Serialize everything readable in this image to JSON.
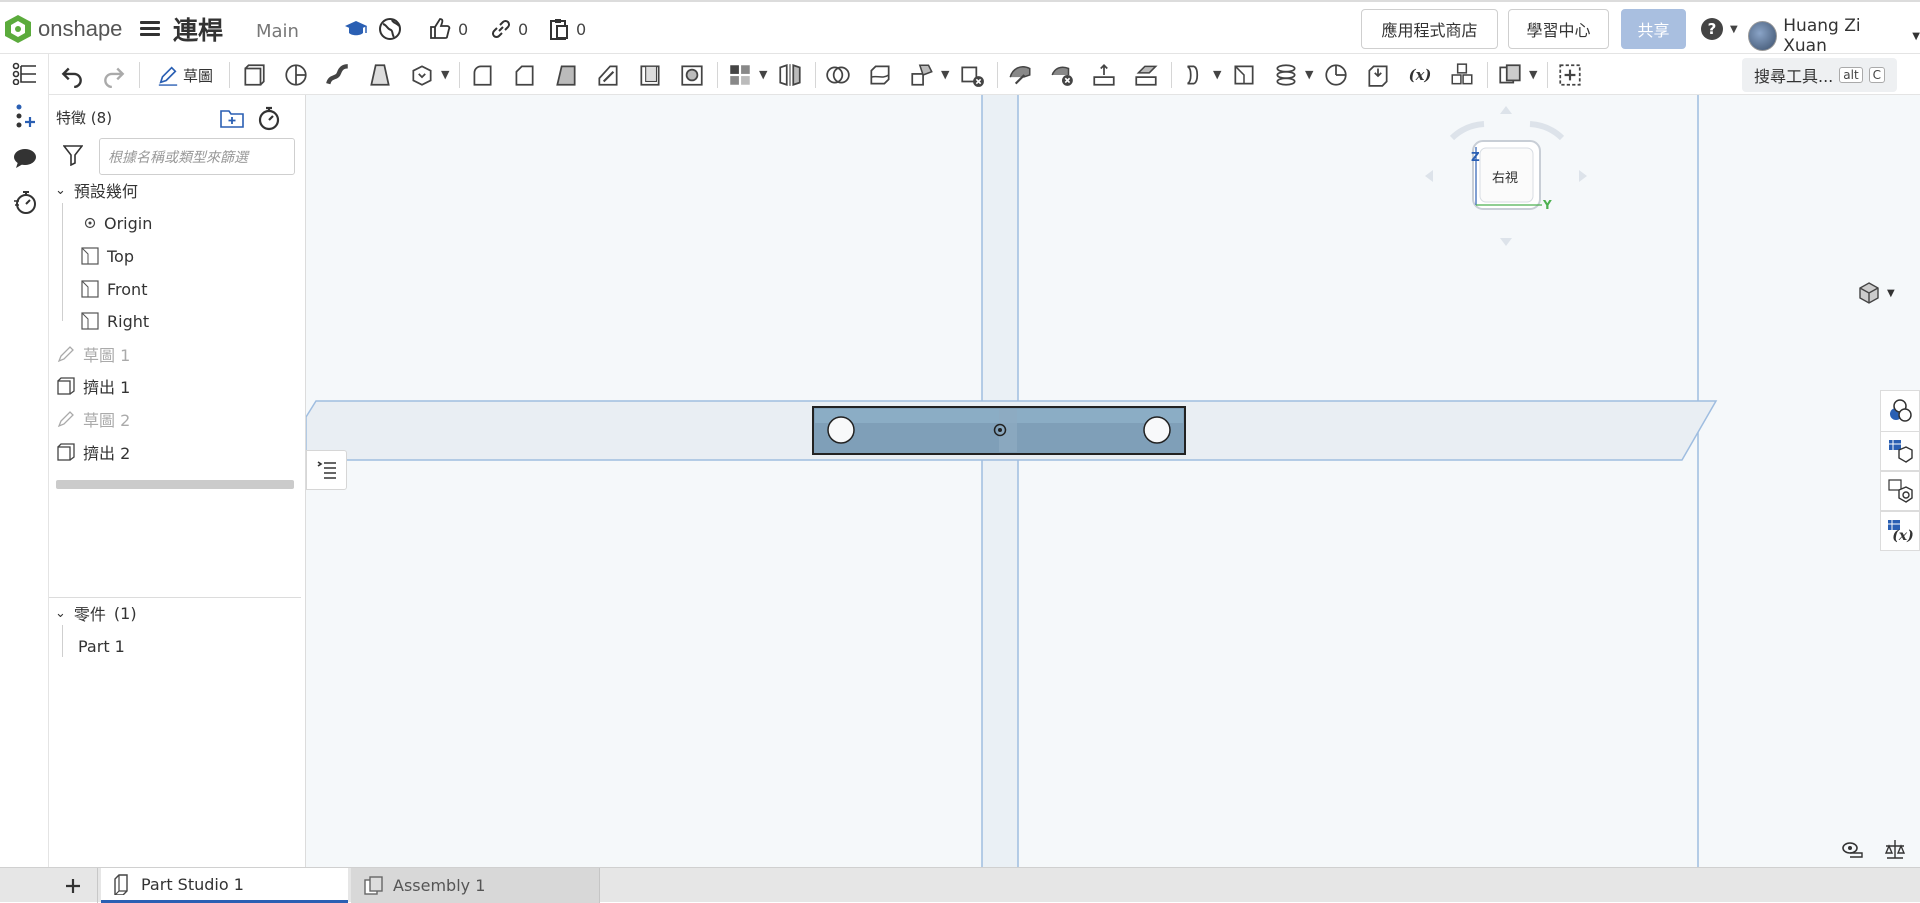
{
  "brand": {
    "name": "onshape"
  },
  "document": {
    "title": "連桿",
    "branch": "Main"
  },
  "counts": {
    "likes": "0",
    "links": "0",
    "copies": "0"
  },
  "header_buttons": {
    "app_store": "應用程式商店",
    "learning_center": "學習中心",
    "share": "共享"
  },
  "user": {
    "name": "Huang Zi Xuan"
  },
  "toolbar": {
    "sketch_label": "草圖",
    "search_label": "搜尋工具...",
    "search_key1": "alt",
    "search_key2": "C"
  },
  "feature_panel": {
    "header_label": "特徵",
    "header_count": "(8)",
    "filter_placeholder": "根據名稱或類型來篩選",
    "default_geometry_label": "預設幾何",
    "geometry_items": [
      "Origin",
      "Top",
      "Front",
      "Right"
    ],
    "features": [
      {
        "label": "草圖 1",
        "type": "sketch",
        "muted": true
      },
      {
        "label": "擠出 1",
        "type": "extrude",
        "muted": false
      },
      {
        "label": "草圖 2",
        "type": "sketch",
        "muted": true
      },
      {
        "label": "擠出 2",
        "type": "extrude",
        "muted": false
      }
    ],
    "parts_label": "零件",
    "parts_count": "(1)",
    "parts": [
      "Part 1"
    ]
  },
  "viewcube": {
    "face_label": "右視",
    "axis_z": "Z",
    "axis_y": "Y"
  },
  "tabs": [
    {
      "label": "Part Studio 1",
      "active": true
    },
    {
      "label": "Assembly 1",
      "active": false
    }
  ],
  "colors": {
    "accent": "#2a5fb3",
    "share_button": "#a9bfe0",
    "part_fill": "#7f9fb8",
    "plane_stroke": "#9fbde0",
    "canvas_bg": "#f5f8fa"
  }
}
